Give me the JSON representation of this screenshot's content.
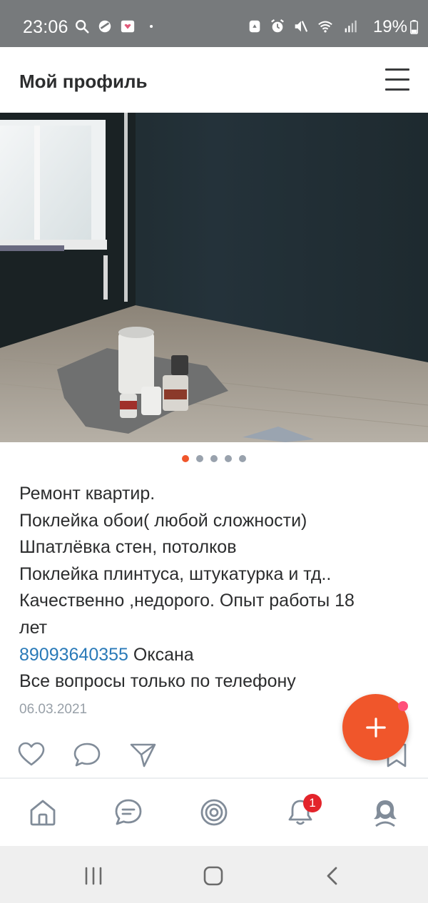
{
  "status_bar": {
    "time": "23:06",
    "battery": "19%",
    "left_icons": [
      "search-icon",
      "shield-icon",
      "gallery-icon",
      "dot-icon"
    ],
    "right_icons": [
      "recycle-icon",
      "alarm-icon",
      "mute-icon",
      "wifi-icon",
      "signal-icon"
    ]
  },
  "header": {
    "title": "Мой профиль",
    "menu_icon": "hamburger-menu-icon"
  },
  "carousel": {
    "total": 5,
    "active_index": 0
  },
  "post": {
    "lines": [
      "Ремонт квартир.",
      "Поклейка обои( любой сложности)",
      "Шпатлёвка стен, потолков",
      "Поклейка плинтуса, штукатурка и тд..",
      "Качественно ,недорого. Опыт работы 18",
      "лет"
    ],
    "phone": "89093640355",
    "contact_name": " Оксана",
    "last_line": "Все вопросы только по телефону",
    "date": "06.03.2021"
  },
  "tabs": [
    "home-icon",
    "messages-icon",
    "discover-icon",
    "notifications-icon",
    "profile-icon"
  ],
  "notifications_badge": "1",
  "colors": {
    "accent": "#f0562b",
    "link": "#2a7ab8",
    "badge": "#e3242b",
    "status_bar": "#777a7c"
  }
}
